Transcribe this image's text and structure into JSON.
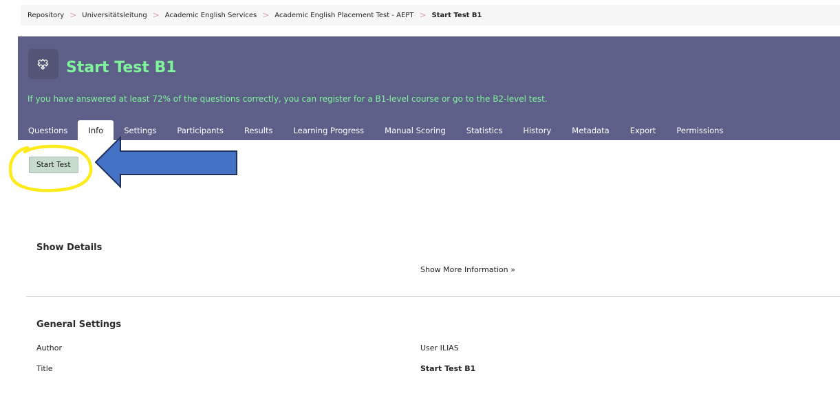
{
  "breadcrumb": {
    "items": [
      "Repository",
      "Universitätsleitung",
      "Academic English Services",
      "Academic English Placement Test - AEPT"
    ],
    "current": "Start Test B1",
    "separator": ">"
  },
  "header": {
    "icon": "puzzle-icon",
    "title": "Start Test B1",
    "description": "If you have answered at least 72% of the questions correctly, you can register for a B1-level course or go to the B2-level test."
  },
  "tabs": [
    "Questions",
    "Info",
    "Settings",
    "Participants",
    "Results",
    "Learning Progress",
    "Manual Scoring",
    "Statistics",
    "History",
    "Metadata",
    "Export",
    "Permissions"
  ],
  "active_tab": "Info",
  "toolbar": {
    "start_test_label": "Start Test"
  },
  "details": {
    "heading": "Show Details",
    "show_more_label": "Show More Information »"
  },
  "general_settings": {
    "heading": "General Settings",
    "author_label": "Author",
    "author_value": "User ILIAS",
    "title_label": "Title",
    "title_value": "Start Test B1"
  },
  "colors": {
    "header_bg": "#5e5f88",
    "title_green": "#7ff59b",
    "button_bg": "#c8dccd",
    "annotation_yellow": "#ffeb1a",
    "arrow_blue": "#4472c4"
  }
}
